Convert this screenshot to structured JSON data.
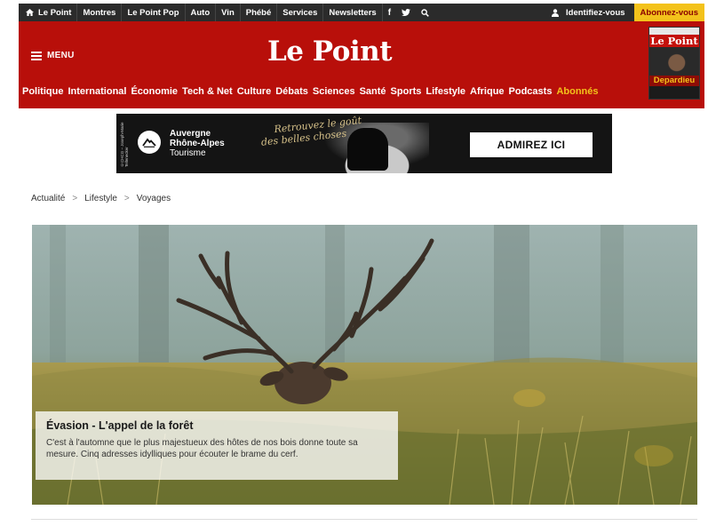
{
  "topbar": {
    "items": [
      "Le Point",
      "Montres",
      "Le Point Pop",
      "Auto",
      "Vin",
      "Phébé",
      "Services",
      "Newsletters"
    ],
    "icons": [
      "home-icon",
      "facebook-icon",
      "twitter-icon",
      "search-icon"
    ],
    "login_label": "Identifiez-vous",
    "subscribe_label": "Abonnez-vous"
  },
  "header": {
    "menu_label": "MENU",
    "logo": "Le Point",
    "magazine": {
      "title": "Le Point",
      "name": "Depardieu"
    },
    "nav": [
      {
        "label": "Politique",
        "accent": false
      },
      {
        "label": "International",
        "accent": false
      },
      {
        "label": "Économie",
        "accent": false
      },
      {
        "label": "Tech & Net",
        "accent": false
      },
      {
        "label": "Culture",
        "accent": false
      },
      {
        "label": "Débats",
        "accent": false
      },
      {
        "label": "Sciences",
        "accent": false
      },
      {
        "label": "Santé",
        "accent": false
      },
      {
        "label": "Sports",
        "accent": false
      },
      {
        "label": "Lifestyle",
        "accent": false
      },
      {
        "label": "Afrique",
        "accent": false
      },
      {
        "label": "Podcasts",
        "accent": false
      },
      {
        "label": "Abonnés",
        "accent": true
      }
    ]
  },
  "ad": {
    "brand_line1": "Auvergne",
    "brand_line2": "Rhône-Alpes",
    "brand_line3": "Tourisme",
    "vertical_text": "©CHCG – Joseph-Marie Tellenecker",
    "script_line1": "Retrouvez le goût",
    "script_line2": "des belles choses",
    "cta": "ADMIREZ ICI"
  },
  "breadcrumb": [
    "Actualité",
    "Lifestyle",
    "Voyages"
  ],
  "article": {
    "title": "Évasion - L'appel de la forêt",
    "summary": "C'est à l'automne que le plus majestueux des hôtes de nos bois donne toute sa mesure. Cinq adresses idylliques pour écouter le brame du cerf."
  },
  "colors": {
    "brand_red": "#b80f0a",
    "topbar": "#2b2b2b",
    "accent_yellow": "#f3c21b"
  }
}
